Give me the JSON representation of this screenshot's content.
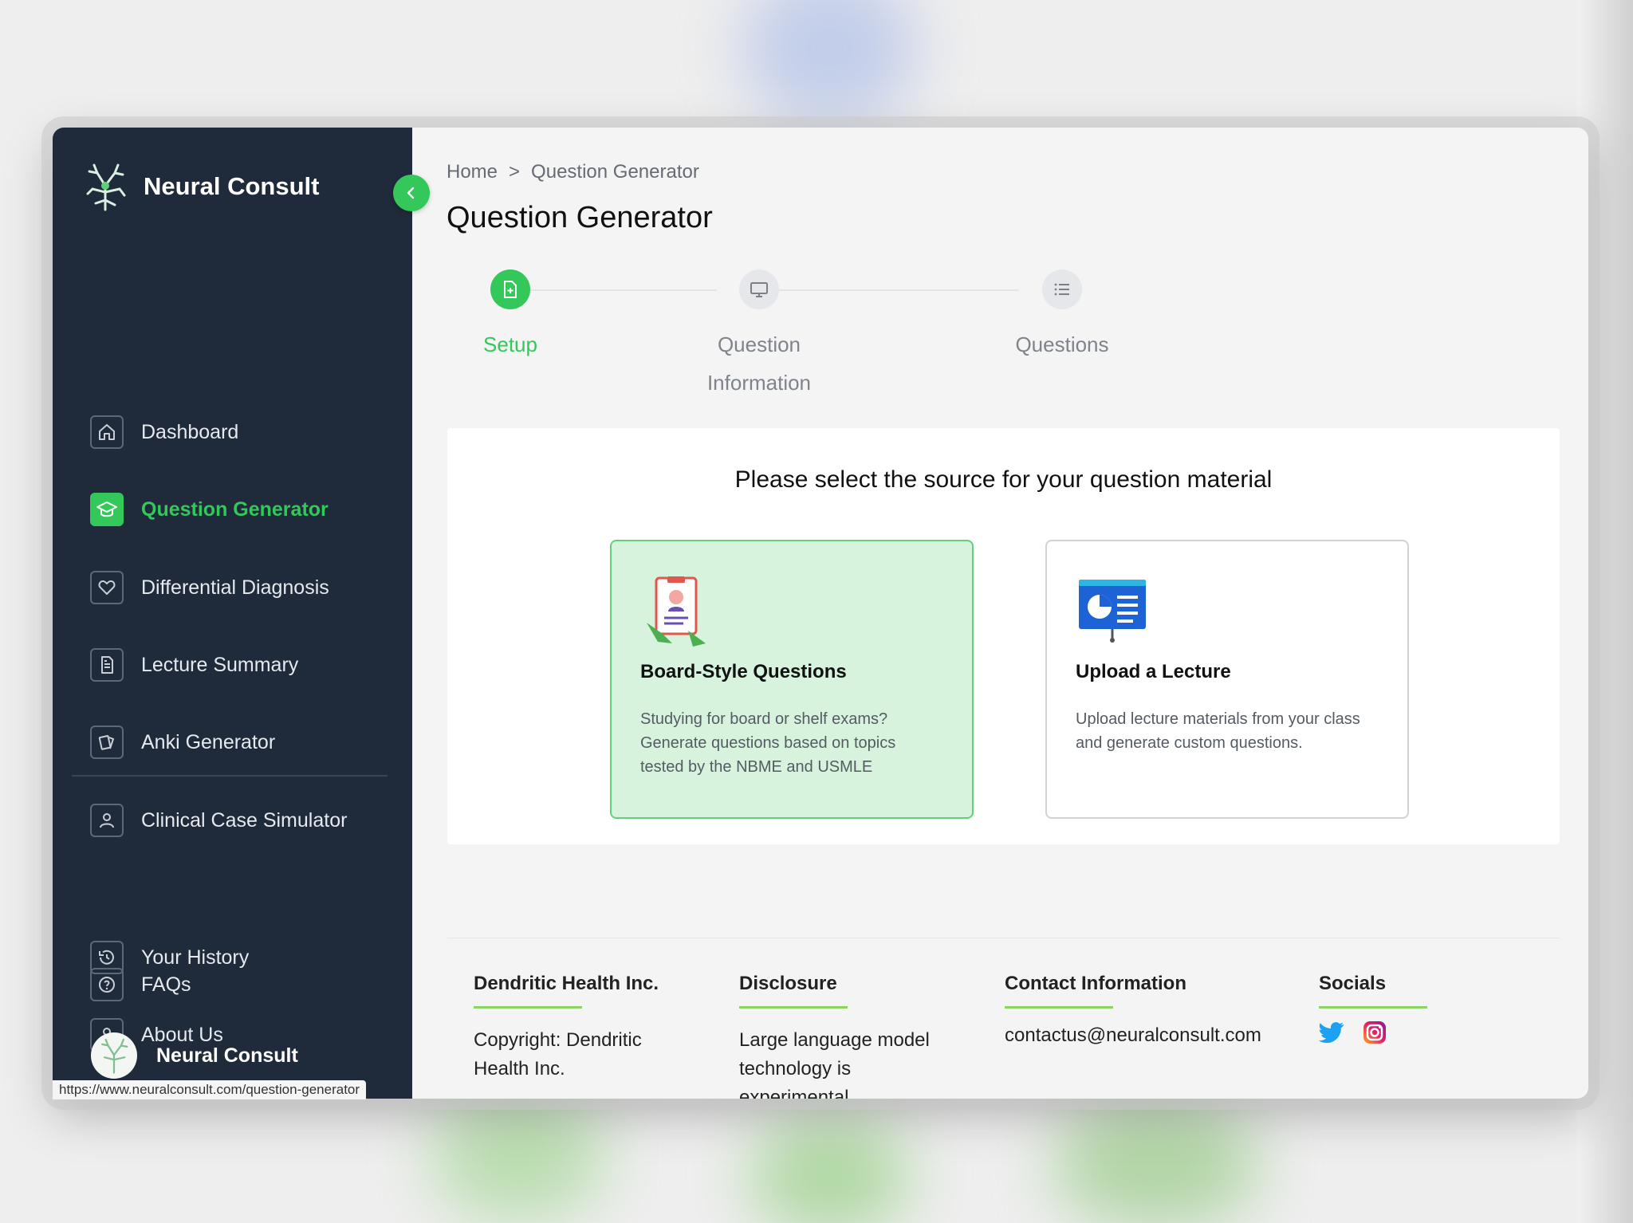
{
  "app": {
    "name": "Neural Consult",
    "accent": "#34c759",
    "sidebar_bg": "#1f2a3a"
  },
  "sidebar": {
    "items": [
      {
        "label": "Dashboard",
        "icon": "home-icon"
      },
      {
        "label": "Question Generator",
        "icon": "graduation-cap-icon",
        "active": true
      },
      {
        "label": "Differential Diagnosis",
        "icon": "heart-icon"
      },
      {
        "label": "Lecture Summary",
        "icon": "document-icon"
      },
      {
        "label": "Anki Generator",
        "icon": "cards-icon"
      },
      {
        "label": "Clinical Case Simulator",
        "icon": "person-icon"
      }
    ],
    "secondary": [
      {
        "label": "Your History",
        "icon": "history-icon"
      },
      {
        "label": "About Us",
        "icon": "person-icon"
      },
      {
        "label": "FAQs",
        "icon": "question-icon"
      }
    ],
    "user_name": "Neural Consult"
  },
  "status_url": "https://www.neuralconsult.com/question-generator",
  "breadcrumb": {
    "home": "Home",
    "separator": ">",
    "current": "Question Generator"
  },
  "page_title": "Question Generator",
  "stepper": {
    "steps": [
      {
        "label": "Setup",
        "icon": "file-plus-icon",
        "active": true
      },
      {
        "label_line1": "Question",
        "label_line2": "Information",
        "icon": "monitor-icon"
      },
      {
        "label": "Questions",
        "icon": "list-icon"
      }
    ]
  },
  "source_panel": {
    "title": "Please select the source for your question material",
    "cards": [
      {
        "title": "Board-Style Questions",
        "description": "Studying for board or shelf exams? Generate questions based on topics tested by the NBME and USMLE",
        "icon": "clipboard-icon",
        "selected": true
      },
      {
        "title": "Upload a Lecture",
        "description": "Upload lecture materials from your class and generate custom questions.",
        "icon": "presentation-icon"
      }
    ]
  },
  "footer": {
    "company": {
      "heading": "Dendritic Health Inc.",
      "text_line1": "Copyright: Dendritic",
      "text_line2": "Health Inc."
    },
    "disclosure": {
      "heading": "Disclosure",
      "text_line1": "Large language model",
      "text_line2": "technology is",
      "text_line3": "experimental"
    },
    "contact": {
      "heading": "Contact Information",
      "email": "contactus@neuralconsult.com"
    },
    "socials": {
      "heading": "Socials",
      "icons": [
        "twitter-icon",
        "instagram-icon"
      ]
    }
  }
}
